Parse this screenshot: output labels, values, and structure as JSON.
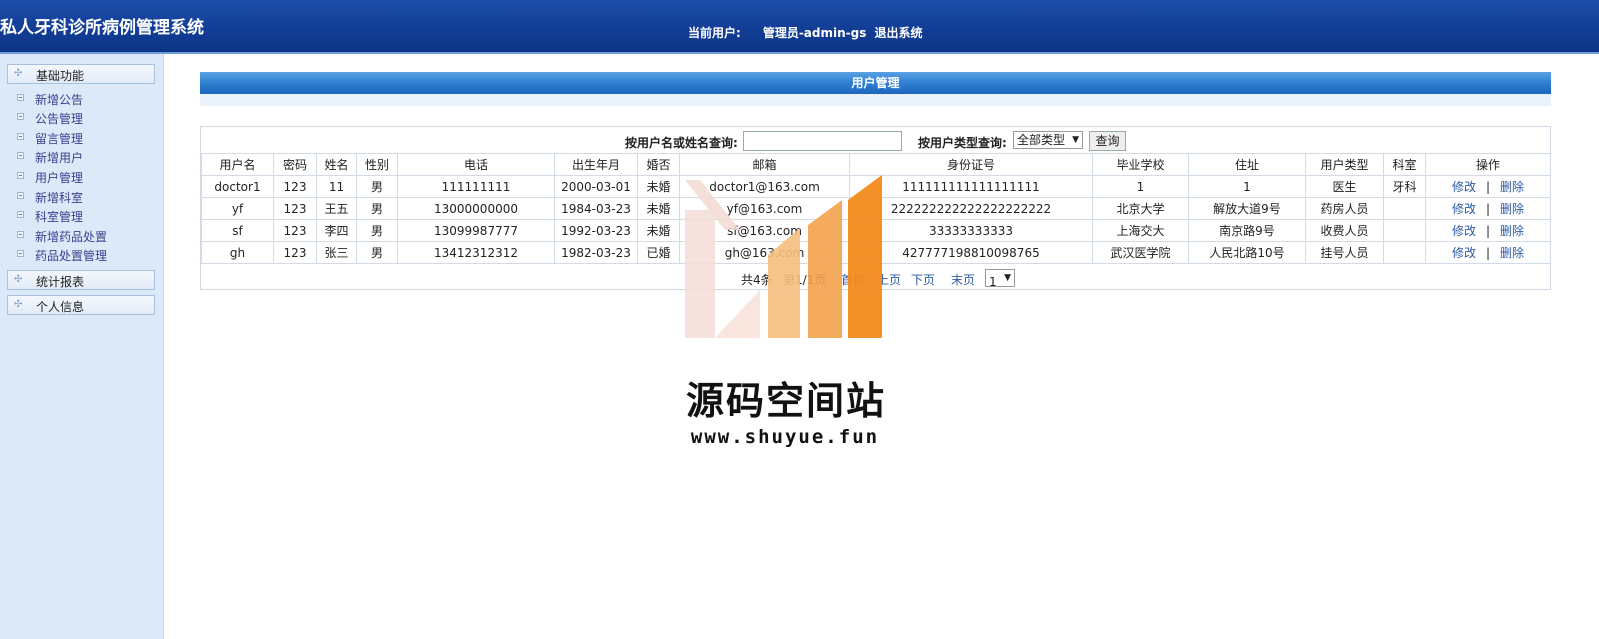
{
  "header": {
    "title": "私人牙科诊所病例管理系统",
    "current_user_label": "当前用户:",
    "current_user": "管理员-admin-gs",
    "logout": "退出系统"
  },
  "sidebar": {
    "sections": [
      {
        "label": "基础功能",
        "items": [
          "新增公告",
          "公告管理",
          "留言管理",
          "新增用户",
          "用户管理",
          "新增科室",
          "科室管理",
          "新增药品处置",
          "药品处置管理"
        ]
      },
      {
        "label": "统计报表",
        "items": []
      },
      {
        "label": "个人信息",
        "items": []
      }
    ]
  },
  "panel": {
    "title": "用户管理"
  },
  "search": {
    "name_label": "按用户名或姓名查询:",
    "name_value": "",
    "type_label": "按用户类型查询:",
    "type_selected": "全部类型",
    "button": "查询"
  },
  "table": {
    "headers": [
      "用户名",
      "密码",
      "姓名",
      "性别",
      "电话",
      "出生年月",
      "婚否",
      "邮箱",
      "身份证号",
      "毕业学校",
      "住址",
      "用户类型",
      "科室",
      "操作"
    ],
    "rows": [
      [
        "doctor1",
        "123",
        "11",
        "男",
        "111111111",
        "2000-03-01",
        "未婚",
        "doctor1@163.com",
        "111111111111111111",
        "1",
        "1",
        "医生",
        "牙科"
      ],
      [
        "yf",
        "123",
        "王五",
        "男",
        "13000000000",
        "1984-03-23",
        "未婚",
        "yf@163.com",
        "222222222222222222222",
        "北京大学",
        "解放大道9号",
        "药房人员",
        ""
      ],
      [
        "sf",
        "123",
        "李四",
        "男",
        "13099987777",
        "1992-03-23",
        "未婚",
        "sf@163.com",
        "33333333333",
        "上海交大",
        "南京路9号",
        "收费人员",
        ""
      ],
      [
        "gh",
        "123",
        "张三",
        "男",
        "13412312312",
        "1982-03-23",
        "已婚",
        "gh@163.com",
        "427777198810098765",
        "武汉医学院",
        "人民北路10号",
        "挂号人员",
        ""
      ]
    ],
    "edit": "修改",
    "sep": "|",
    "delete": "删除"
  },
  "pager": {
    "count_text": "共4条",
    "page_text": "第1/1页",
    "first": "首页",
    "prev": "上页",
    "next": "下页",
    "last": "末页",
    "page_select": "1"
  },
  "watermark": {
    "text": "源码空间站",
    "url": "www.shuyue.fun"
  },
  "colors": {
    "header": "#14409a",
    "sidebar": "#dce9f8",
    "panel_title": "#2f7fd0",
    "link": "#2b5aa4",
    "watermark_orange": "#f28a1c"
  }
}
